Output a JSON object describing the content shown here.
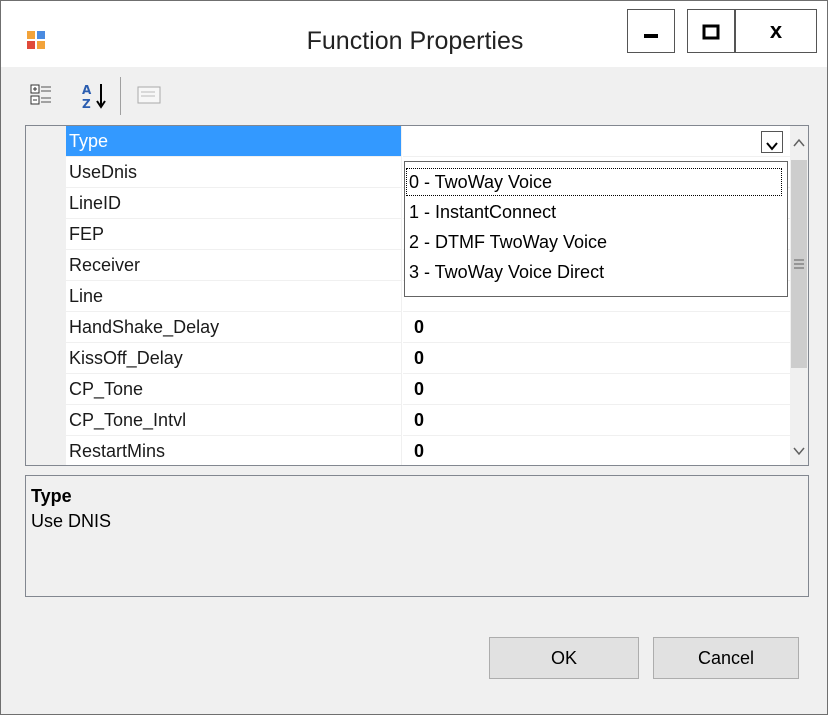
{
  "window": {
    "title": "Function Properties",
    "minimize_label": "—",
    "maximize_label": "□",
    "close_label": "x"
  },
  "property_grid": {
    "rows": [
      {
        "name": "Type",
        "value": "",
        "selected": true
      },
      {
        "name": "UseDnis",
        "value": ""
      },
      {
        "name": "LineID",
        "value": ""
      },
      {
        "name": "FEP",
        "value": ""
      },
      {
        "name": "Receiver",
        "value": ""
      },
      {
        "name": "Line",
        "value": ""
      },
      {
        "name": "HandShake_Delay",
        "value": "0"
      },
      {
        "name": "KissOff_Delay",
        "value": "0"
      },
      {
        "name": "CP_Tone",
        "value": "0"
      },
      {
        "name": "CP_Tone_Intvl",
        "value": "0"
      },
      {
        "name": "RestartMins",
        "value": "0"
      }
    ],
    "dropdown_options": [
      "0 - TwoWay Voice",
      "1 - InstantConnect",
      "2 - DTMF TwoWay Voice",
      "3 - TwoWay Voice Direct"
    ],
    "highlighted_option": 0
  },
  "description": {
    "title": "Type",
    "text": "Use DNIS"
  },
  "buttons": {
    "ok": "OK",
    "cancel": "Cancel"
  },
  "colors": {
    "selection": "#3399ff",
    "window_bg": "#f0f0f0"
  }
}
